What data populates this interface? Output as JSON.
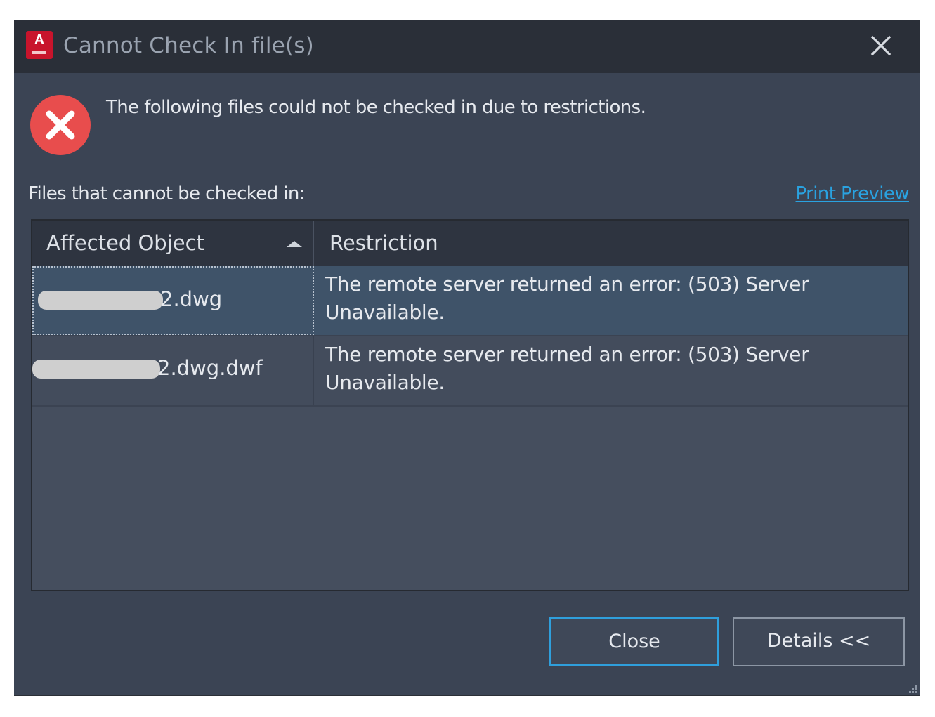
{
  "window": {
    "title": "Cannot Check In file(s)",
    "app_icon_letter": "A"
  },
  "message": "The following files could not be checked in due to restrictions.",
  "files_label": "Files that cannot be checked in:",
  "print_preview_label": "Print Preview",
  "table": {
    "columns": [
      "Affected Object",
      "Restriction"
    ],
    "sort_indicator": "ascending",
    "rows": [
      {
        "affected_object_visible": "2.dwg",
        "restriction_line1": "The remote server returned an error: (503) Server",
        "restriction_line2": "Unavailable.",
        "selected": true
      },
      {
        "affected_object_visible": "2.dwg.dwf",
        "restriction_line1": "The remote server returned an error: (503) Server",
        "restriction_line2": "Unavailable.",
        "selected": false
      }
    ]
  },
  "buttons": {
    "close_label": "Close",
    "details_label": "Details <<"
  },
  "colors": {
    "dialog_bg": "#3b4454",
    "titlebar_bg": "#2a2f38",
    "accent": "#2f9fdc",
    "error_red": "#e84d4d",
    "link": "#2aa2e0"
  }
}
